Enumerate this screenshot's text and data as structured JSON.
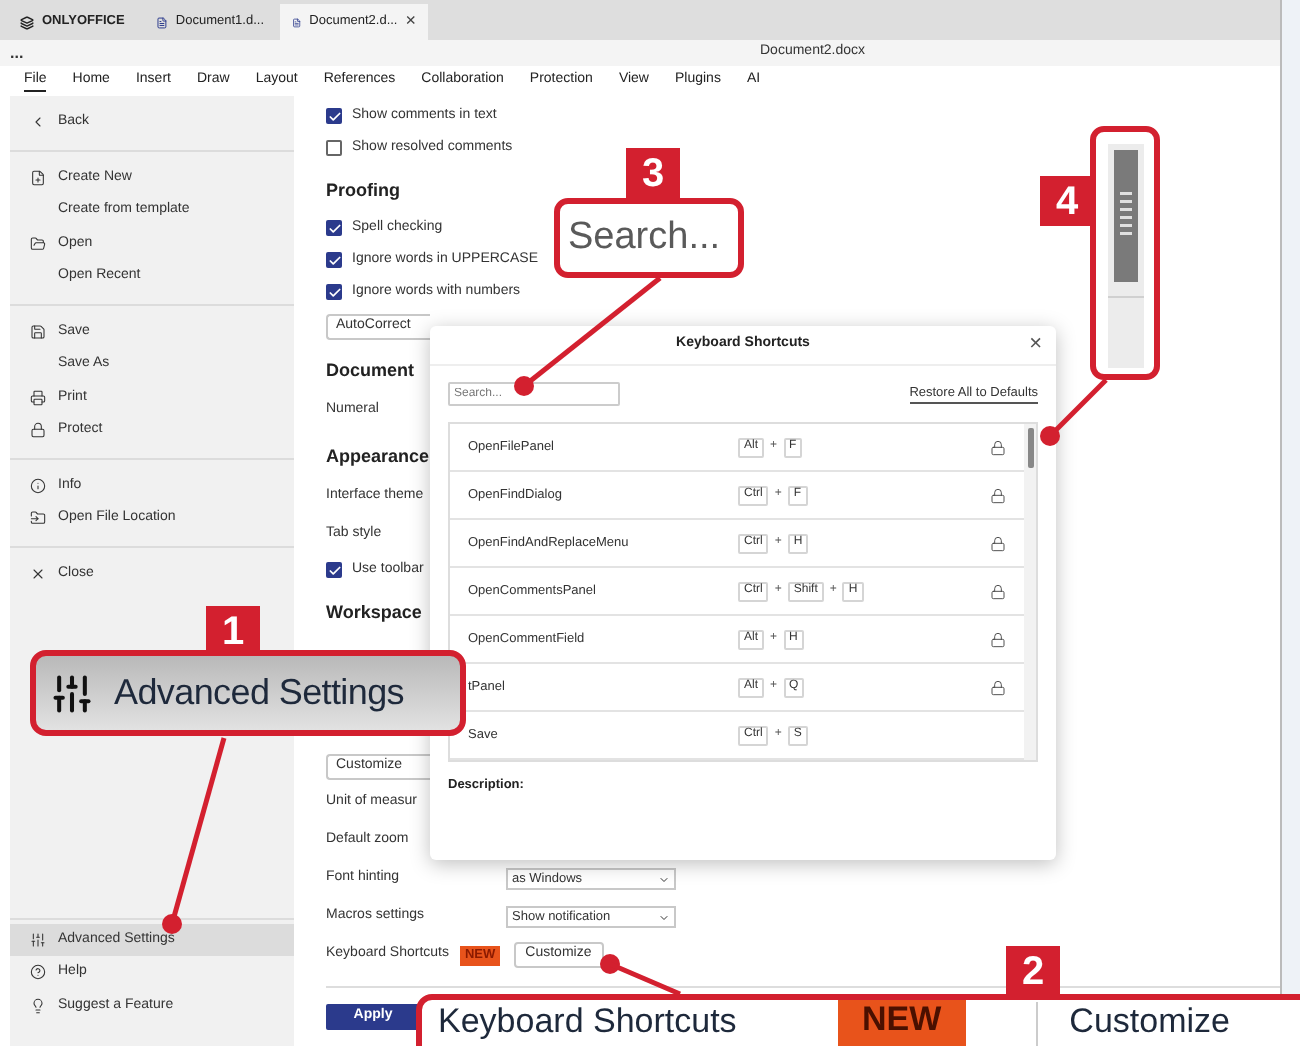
{
  "tabs": [
    {
      "label": "ONLYOFFICE",
      "kind": "logo",
      "selected": false
    },
    {
      "label": "Document1.d...",
      "kind": "doc",
      "selected": false
    },
    {
      "label": "Document2.d...",
      "kind": "doc",
      "selected": true,
      "close": "×"
    }
  ],
  "title_bar": {
    "more": "...",
    "title": "Document2.docx"
  },
  "menu": [
    {
      "label": "File",
      "selected": true
    },
    {
      "label": "Home",
      "selected": false
    },
    {
      "label": "Insert",
      "selected": false
    },
    {
      "label": "Draw",
      "selected": false
    },
    {
      "label": "Layout",
      "selected": false
    },
    {
      "label": "References",
      "selected": false
    },
    {
      "label": "Collaboration",
      "selected": false
    },
    {
      "label": "Protection",
      "selected": false
    },
    {
      "label": "View",
      "selected": false
    },
    {
      "label": "Plugins",
      "selected": false
    },
    {
      "label": "AI",
      "selected": false
    }
  ],
  "sidebar": {
    "groups": [
      [
        {
          "label": "Back",
          "kind": "back",
          "selected": false
        }
      ],
      [
        {
          "label": "Create New",
          "kind": "new",
          "selected": false
        },
        {
          "label": "Create from template",
          "kind": "none",
          "selected": false
        },
        {
          "label": "Open",
          "kind": "open",
          "selected": false
        },
        {
          "label": "Open Recent",
          "kind": "none",
          "selected": false
        }
      ],
      [
        {
          "label": "Save",
          "kind": "save",
          "selected": false
        },
        {
          "label": "Save As",
          "kind": "none",
          "selected": false
        },
        {
          "label": "Print",
          "kind": "print",
          "selected": false
        },
        {
          "label": "Protect",
          "kind": "lock",
          "selected": false
        }
      ],
      [
        {
          "label": "Info",
          "kind": "info",
          "selected": false
        },
        {
          "label": "Open File Location",
          "kind": "folder",
          "selected": false
        }
      ],
      [
        {
          "label": "Close",
          "kind": "close",
          "selected": false
        }
      ]
    ],
    "bottom": [
      {
        "label": "Advanced Settings",
        "kind": "sliders",
        "selected": true
      },
      {
        "label": "Help",
        "kind": "help",
        "selected": false
      },
      {
        "label": "Suggest a Feature",
        "kind": "bulb",
        "selected": false
      }
    ]
  },
  "settings": [
    {
      "kind": "checkbox",
      "label": "Show comments in text",
      "checked": true
    },
    {
      "kind": "checkbox",
      "label": "Show resolved comments",
      "checked": false
    },
    {
      "kind": "heading",
      "label": "Proofing"
    },
    {
      "kind": "checkbox",
      "label": "Spell checking",
      "checked": true
    },
    {
      "kind": "checkbox",
      "label": "Ignore words in UPPERCASE",
      "checked": true
    },
    {
      "kind": "checkbox",
      "label": "Ignore words with numbers",
      "checked": true
    },
    {
      "kind": "button",
      "label": "AutoCorrect"
    },
    {
      "kind": "heading",
      "label": "Document"
    },
    {
      "kind": "label",
      "label": "Numeral"
    },
    {
      "kind": "heading",
      "label": "Appearance"
    },
    {
      "kind": "label",
      "label": "Interface theme"
    },
    {
      "kind": "label",
      "label": "Tab style"
    },
    {
      "kind": "checkbox",
      "label": "Use toolbar",
      "checked": true
    },
    {
      "kind": "heading",
      "label": "Workspace"
    }
  ],
  "workspace": [
    {
      "kind": "button",
      "label": "Customize"
    },
    {
      "kind": "label",
      "label": "Unit of measur"
    },
    {
      "kind": "label",
      "label": "Default zoom"
    },
    {
      "kind": "select",
      "label": "Font hinting",
      "value": "as Windows"
    },
    {
      "kind": "select",
      "label": "Macros settings",
      "value": "Show notification"
    },
    {
      "kind": "shortcut",
      "label": "Keyboard Shortcuts",
      "badge": "NEW",
      "button": "Customize"
    }
  ],
  "apply": "Apply",
  "dialog": {
    "title": "Keyboard Shortcuts",
    "close": "×",
    "search": {
      "placeholder": "Search..."
    },
    "restore": "Restore All to Defaults",
    "rows": [
      {
        "action": "OpenFilePanel",
        "keys": [
          "Alt",
          "F"
        ],
        "locked": true
      },
      {
        "action": "OpenFindDialog",
        "keys": [
          "Ctrl",
          "F"
        ],
        "locked": true
      },
      {
        "action": "OpenFindAndReplaceMenu",
        "keys": [
          "Ctrl",
          "H"
        ],
        "locked": true
      },
      {
        "action": "OpenCommentsPanel",
        "keys": [
          "Ctrl",
          "Shift",
          "H"
        ],
        "locked": true
      },
      {
        "action": "OpenCommentField",
        "keys": [
          "Alt",
          "H"
        ],
        "locked": true
      },
      {
        "action": "tPanel",
        "keys": [
          "Alt",
          "Q"
        ],
        "locked": true
      },
      {
        "action": "Save",
        "keys": [
          "Ctrl",
          "S"
        ],
        "locked": false
      }
    ],
    "plus": "+",
    "description": "Description:"
  },
  "callouts": [
    {
      "number": "3",
      "kind": "search",
      "text": "Search..."
    },
    {
      "number": "4",
      "kind": "scrollbar"
    },
    {
      "number": "1",
      "kind": "sidebar",
      "text": "Advanced Settings"
    },
    {
      "number": "2",
      "kind": "shortcut",
      "text": "Keyboard Shortcuts",
      "badge": "NEW",
      "button": "Customize"
    }
  ]
}
